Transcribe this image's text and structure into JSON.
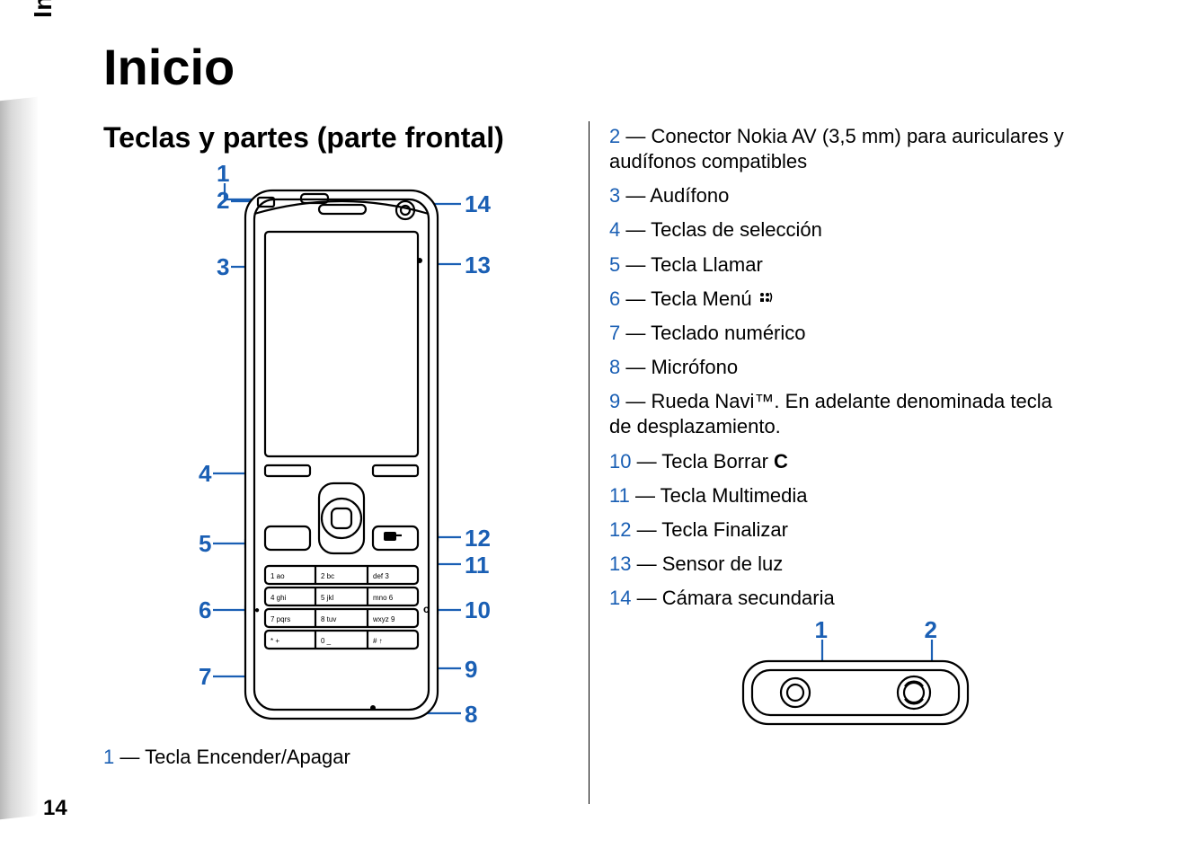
{
  "sideTab": "Inicio",
  "pageNumber": "14",
  "title": "Inicio",
  "subtitle": "Teclas y partes (parte frontal)",
  "frontLabels": {
    "n1": "1",
    "n2": "2",
    "n3": "3",
    "n4": "4",
    "n5": "5",
    "n6": "6",
    "n7": "7",
    "n8": "8",
    "n9": "9",
    "n10": "10",
    "n11": "11",
    "n12": "12",
    "n13": "13",
    "n14": "14"
  },
  "keypad": {
    "r1c1": "1 ao",
    "r1c2": "2 bc",
    "r1c3": "def 3",
    "r2c1": "4 ghi",
    "r2c2": "5 jkl",
    "r2c3": "mno 6",
    "r3c1": "7 pqrs",
    "r3c2": "8 tuv",
    "r3c3": "wxyz 9",
    "r4c1": "* +",
    "r4c2": "0 _",
    "r4c3": "# ↑"
  },
  "menuKeySymbol": "c",
  "sideKeyLeft": "●",
  "belowLeft": {
    "num": "1",
    "text": " — Tecla Encender/Apagar"
  },
  "legend": [
    {
      "num": "2",
      "text": " — Conector Nokia AV (3,5 mm) para auriculares y audífonos compatibles"
    },
    {
      "num": "3",
      "text": " — Audífono"
    },
    {
      "num": "4",
      "text": " — Teclas de selección"
    },
    {
      "num": "5",
      "text": " — Tecla Llamar"
    },
    {
      "num": "6",
      "text": " — Tecla Menú ",
      "icon": true
    },
    {
      "num": "7",
      "text": " — Teclado numérico"
    },
    {
      "num": "8",
      "text": " — Micrófono"
    },
    {
      "num": "9",
      "text": " — Rueda Navi™. En adelante denominada tecla de desplazamiento."
    },
    {
      "num": "10",
      "text": " — Tecla Borrar ",
      "boldSuffix": "C"
    },
    {
      "num": "11",
      "text": " — Tecla Multimedia"
    },
    {
      "num": "12",
      "text": " — Tecla Finalizar"
    },
    {
      "num": "13",
      "text": " — Sensor de luz"
    },
    {
      "num": "14",
      "text": " — Cámara secundaria"
    }
  ],
  "topLabels": {
    "n1": "1",
    "n2": "2"
  }
}
